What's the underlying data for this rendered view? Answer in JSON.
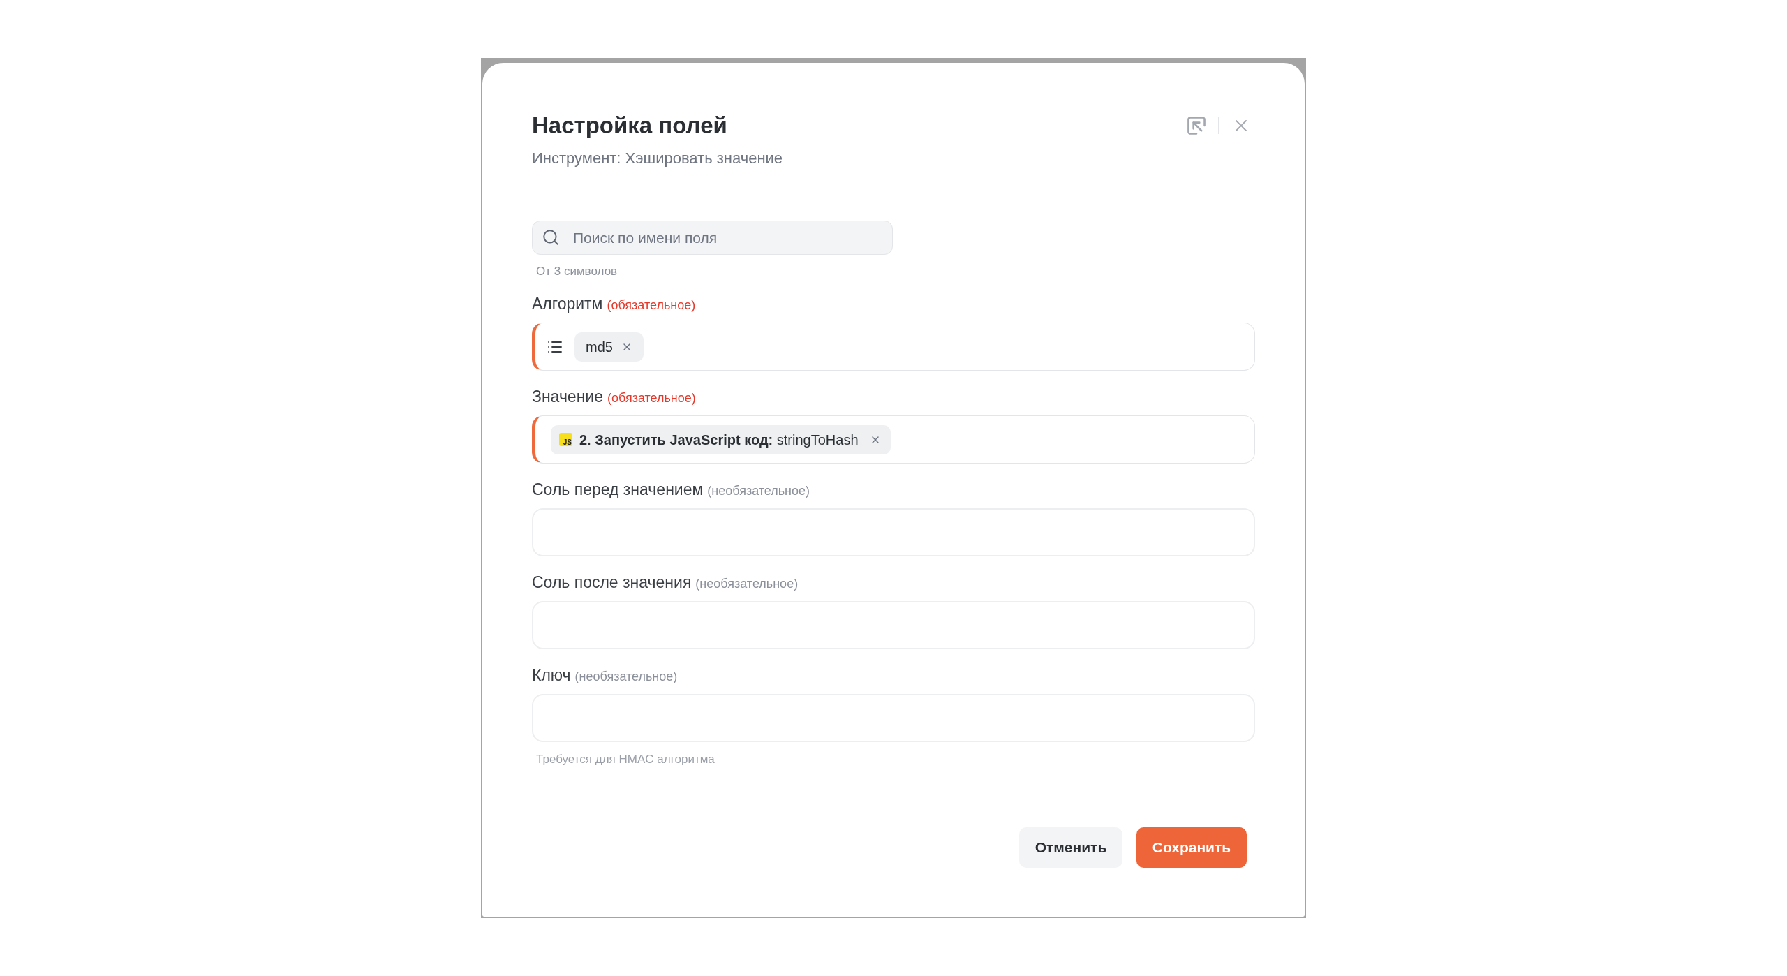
{
  "dialog": {
    "title": "Настройка полей",
    "subtitle": "Инструмент: Хэшировать значение"
  },
  "search": {
    "placeholder": "Поиск по имени поля",
    "hint": "От 3 символов"
  },
  "fields": [
    {
      "label": "Алгоритм",
      "requirement": "(обязательное)",
      "required": true,
      "kind": "select",
      "chips": [
        {
          "kind": "option",
          "text": "md5"
        }
      ]
    },
    {
      "label": "Значение",
      "requirement": "(обязательное)",
      "required": true,
      "kind": "mapped",
      "chips": [
        {
          "kind": "step",
          "badge": "JS",
          "text": "**2. Запустить JavaScript код:** stringToHash"
        }
      ]
    },
    {
      "label": "Соль перед значением",
      "requirement": "(необязательное)",
      "required": false,
      "kind": "text"
    },
    {
      "label": "Соль после значения",
      "requirement": "(необязательное)",
      "required": false,
      "kind": "text"
    },
    {
      "label": "Ключ",
      "requirement": "(необязательное)",
      "required": false,
      "kind": "text",
      "hint": "Требуется для HMAC алгоритма"
    }
  ],
  "buttons": [
    {
      "label": "Отменить",
      "kind": "secondary"
    },
    {
      "label": "Сохранить",
      "kind": "primary"
    }
  ]
}
